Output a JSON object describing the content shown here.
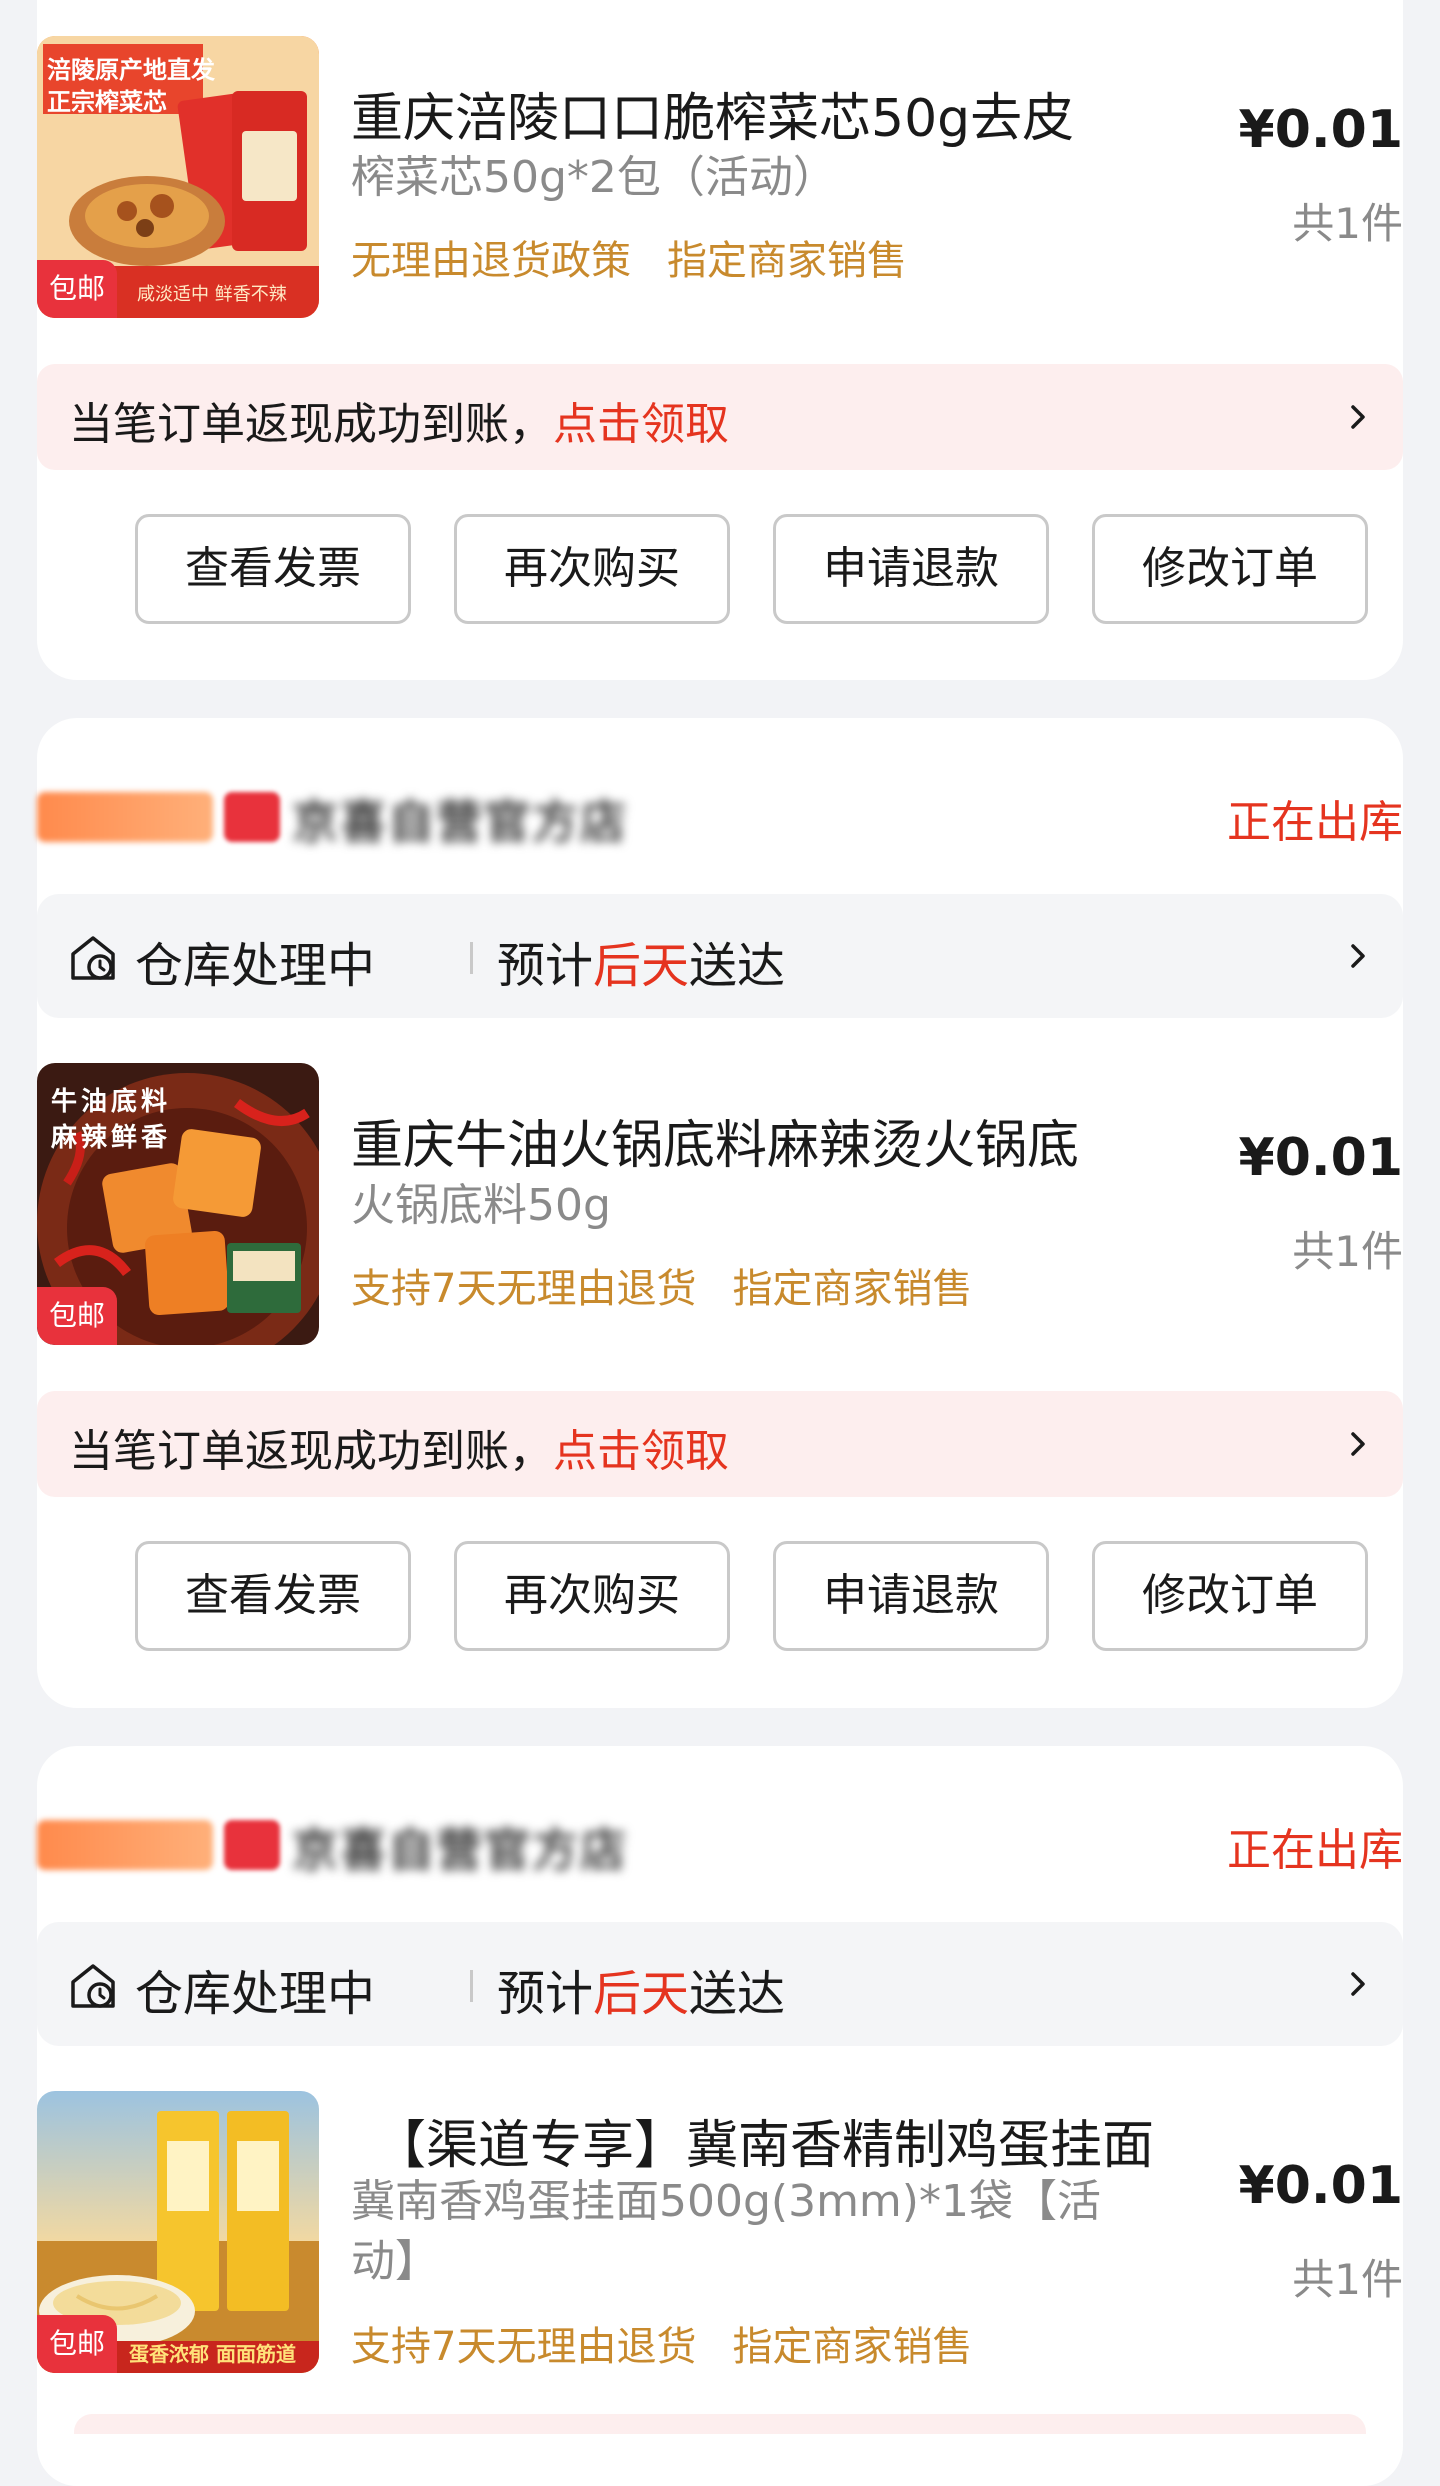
{
  "orders": [
    {
      "product": {
        "title": "重庆涪陵口口脆榨菜芯50g去皮",
        "spec": "榨菜芯50g*2包（活动）",
        "tags": [
          "无理由退货政策",
          "指定商家销售"
        ],
        "price": "¥0.01",
        "qty": "共1件",
        "free_shipping": "包邮",
        "image_text": {
          "line1": "涪陵原产地直发",
          "line2": "正宗榨菜芯",
          "line3": "咸淡适中 鲜香不辣"
        }
      },
      "cashback": {
        "text": "当笔订单返现成功到账，",
        "link": "点击领取"
      },
      "buttons": [
        "查看发票",
        "再次购买",
        "申请退款",
        "修改订单"
      ]
    },
    {
      "shop": {
        "name": "京喜自营官方店",
        "status": "正在出库"
      },
      "shipping": {
        "status": "仓库处理中",
        "eta_prefix": "预计",
        "eta_day": "后天",
        "eta_suffix": "送达"
      },
      "product": {
        "title": "重庆牛油火锅底料麻辣烫火锅底",
        "spec": "火锅底料50g",
        "tags": [
          "支持7天无理由退货",
          "指定商家销售"
        ],
        "price": "¥0.01",
        "qty": "共1件",
        "free_shipping": "包邮",
        "image_text": {
          "line1": "牛油底料",
          "line2": "麻辣鲜香"
        }
      },
      "cashback": {
        "text": "当笔订单返现成功到账，",
        "link": "点击领取"
      },
      "buttons": [
        "查看发票",
        "再次购买",
        "申请退款",
        "修改订单"
      ]
    },
    {
      "shop": {
        "name": "京喜自营官方店",
        "status": "正在出库"
      },
      "shipping": {
        "status": "仓库处理中",
        "eta_prefix": "预计",
        "eta_day": "后天",
        "eta_suffix": "送达"
      },
      "product": {
        "title": "【渠道专享】冀南香精制鸡蛋挂面",
        "spec": "冀南香鸡蛋挂面500g(3mm)*1袋【活动】",
        "tags": [
          "支持7天无理由退货",
          "指定商家销售"
        ],
        "price": "¥0.01",
        "qty": "共1件",
        "free_shipping": "包邮",
        "image_text": {
          "line1": "蛋香浓郁 面面筋道"
        }
      }
    }
  ],
  "colors": {
    "accent": "#e5341f",
    "tag": "#c88a2d",
    "cashback_bg": "#fdeeee",
    "page_bg": "#f2f3f6"
  }
}
